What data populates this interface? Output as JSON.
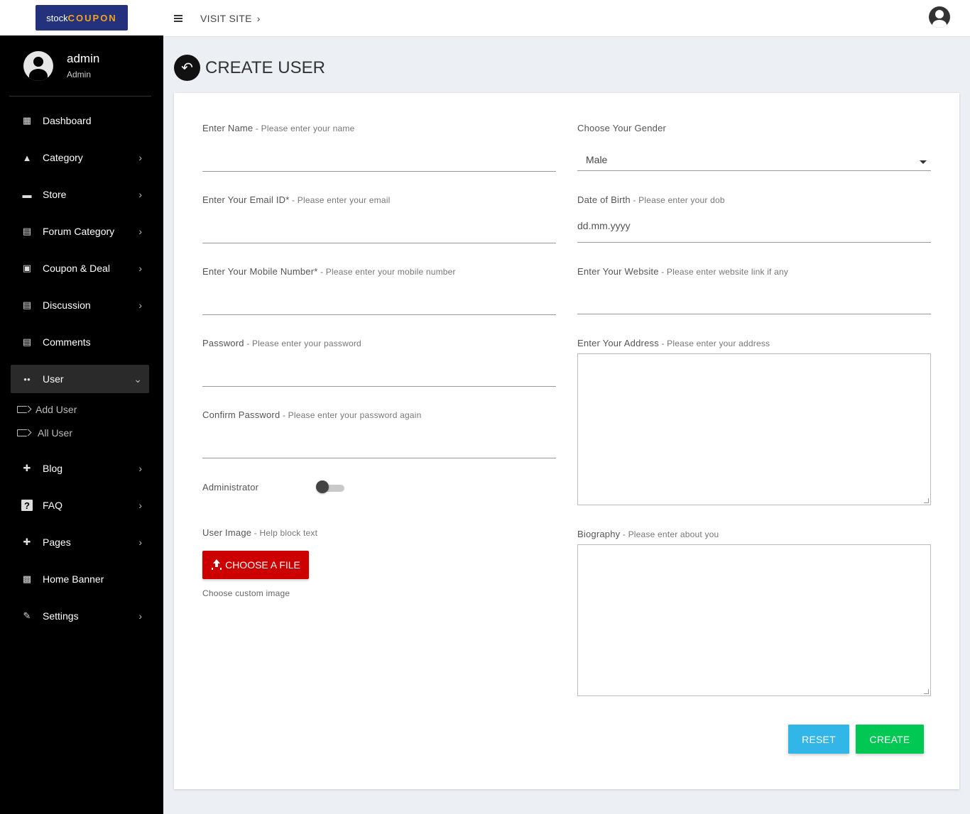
{
  "logo": {
    "part1": "stock",
    "part2": "COUPON"
  },
  "profile": {
    "name": "admin",
    "role": "Admin"
  },
  "topbar": {
    "visit_site": "VISIT SITE",
    "visit_chevron": "›"
  },
  "sidebar": {
    "items": [
      {
        "label": "Dashboard",
        "icon": "dashboard-icon",
        "glyph": "▦",
        "chevron": ""
      },
      {
        "label": "Category",
        "icon": "category-icon",
        "glyph": "▲",
        "chevron": "›"
      },
      {
        "label": "Store",
        "icon": "store-icon",
        "glyph": "▬",
        "chevron": "›"
      },
      {
        "label": "Forum Category",
        "icon": "forum-icon",
        "glyph": "▤",
        "chevron": "›"
      },
      {
        "label": "Coupon & Deal",
        "icon": "coupon-icon",
        "glyph": "▣",
        "chevron": "›"
      },
      {
        "label": "Discussion",
        "icon": "discussion-icon",
        "glyph": "▤",
        "chevron": "›"
      },
      {
        "label": "Comments",
        "icon": "comments-icon",
        "glyph": "▤",
        "chevron": ""
      },
      {
        "label": "User",
        "icon": "users-icon",
        "glyph": "●●",
        "chevron": "⌄"
      },
      {
        "label": "Blog",
        "icon": "blog-icon",
        "glyph": "✚",
        "chevron": "›"
      },
      {
        "label": "FAQ",
        "icon": "faq-icon",
        "glyph": "?",
        "chevron": "›"
      },
      {
        "label": "Pages",
        "icon": "pages-icon",
        "glyph": "✚",
        "chevron": "›"
      },
      {
        "label": "Home Banner",
        "icon": "image-icon",
        "glyph": "▩",
        "chevron": ""
      },
      {
        "label": "Settings",
        "icon": "wrench-icon",
        "glyph": "✎",
        "chevron": "›"
      }
    ],
    "user_sub": [
      {
        "label": "Add User"
      },
      {
        "label": "All User"
      }
    ]
  },
  "page": {
    "title": "CREATE USER",
    "back_glyph": "↶"
  },
  "form": {
    "name": {
      "label": "Enter Name",
      "help": " - Please enter your name"
    },
    "email": {
      "label": "Enter Your Email ID*",
      "help": " - Please enter your email"
    },
    "mobile": {
      "label": "Enter Your Mobile Number*",
      "help": " - Please enter your mobile number"
    },
    "password": {
      "label": "Password",
      "help": " - Please enter your password"
    },
    "confirm": {
      "label": "Confirm Password",
      "help": " - Please enter your password again"
    },
    "admin": {
      "label": "Administrator",
      "enabled": false
    },
    "image": {
      "label": "User Image",
      "help": " - Help block text",
      "button": "CHOOSE A FILE",
      "note": "Choose custom image"
    },
    "gender": {
      "label": "Choose Your Gender",
      "value": "Male"
    },
    "dob": {
      "label": "Date of Birth",
      "help": " - Please enter your dob",
      "placeholder": "dd.mm.yyyy"
    },
    "website": {
      "label": "Enter Your Website",
      "help": " - Please enter website link if any"
    },
    "address": {
      "label": "Enter Your Address",
      "help": " - Please enter your address"
    },
    "bio": {
      "label": "Biography",
      "help": " - Please enter about you"
    },
    "reset": "RESET",
    "create": "CREATE"
  }
}
